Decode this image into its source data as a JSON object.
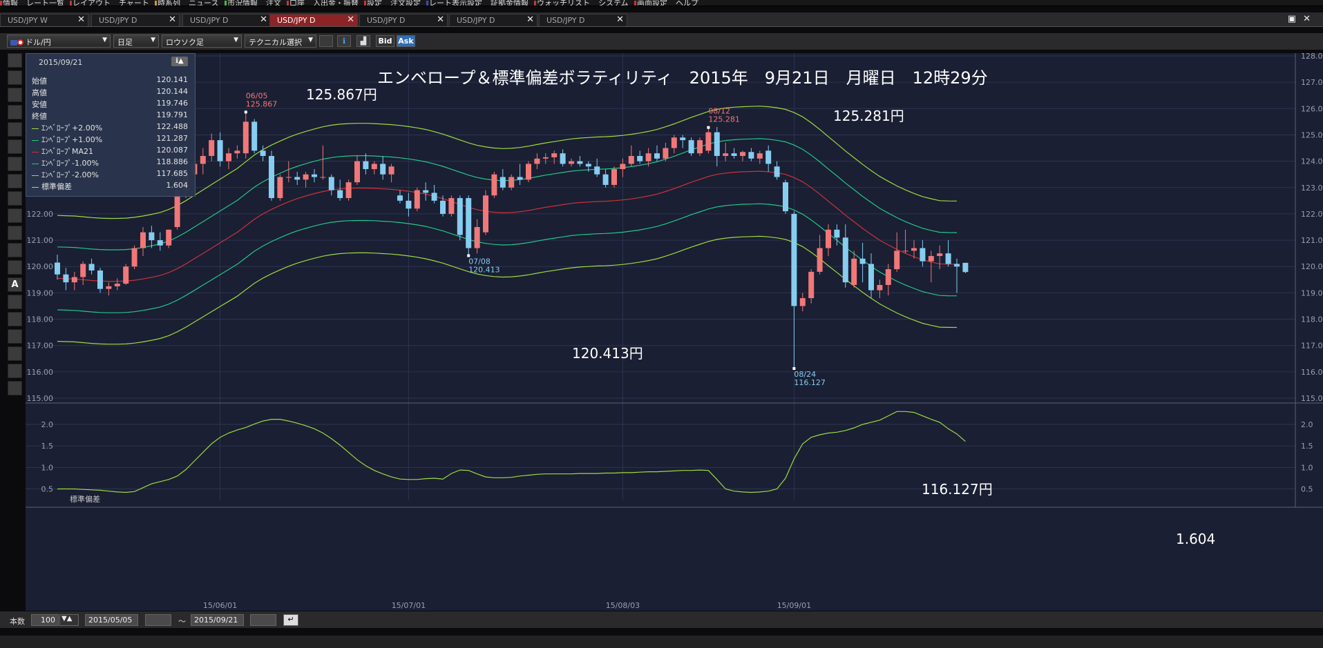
{
  "menu": {
    "items": [
      "情報",
      "レート一覧",
      "レイアウト",
      "チャート",
      "時系列",
      "ニュース",
      "市況情報",
      "注文",
      "口座",
      "入出金・振替",
      "設定",
      "注文設定",
      "レート表示設定",
      "証拠金情報",
      "ウォッチリスト",
      "システム",
      "画面設定",
      "ヘルプ"
    ]
  },
  "tabs": [
    {
      "label": "USD/JPY W",
      "active": false
    },
    {
      "label": "USD/JPY D",
      "active": false
    },
    {
      "label": "USD/JPY D",
      "active": false
    },
    {
      "label": "USD/JPY D",
      "active": true
    },
    {
      "label": "USD/JPY D",
      "active": false
    },
    {
      "label": "USD/JPY D",
      "active": false
    },
    {
      "label": "USD/JPY D",
      "active": false
    }
  ],
  "toolbar": {
    "currency_pair": "ドル/円",
    "timeframe": "日足",
    "chart_type": "ロウソク足",
    "technical_select": "テクニカル選択",
    "bid_label": "Bid",
    "ask_label": "Ask"
  },
  "info_panel": {
    "date": "2015/09/21",
    "rows": [
      {
        "label": "始値",
        "value": "120.141",
        "color": ""
      },
      {
        "label": "高値",
        "value": "120.144",
        "color": ""
      },
      {
        "label": "安値",
        "value": "119.746",
        "color": ""
      },
      {
        "label": "終値",
        "value": "119.791",
        "color": ""
      },
      {
        "label": "ｴﾝﾍﾞﾛｰﾌﾟ+2.00%",
        "value": "122.488",
        "color": "#9edc3e"
      },
      {
        "label": "ｴﾝﾍﾞﾛｰﾌﾟ+1.00%",
        "value": "121.287",
        "color": "#22c98a"
      },
      {
        "label": "ｴﾝﾍﾞﾛｰﾌﾟMA21",
        "value": "120.087",
        "color": "#d0313a"
      },
      {
        "label": "ｴﾝﾍﾞﾛｰﾌﾟ-1.00%",
        "value": "118.886",
        "color": "#22c98a"
      },
      {
        "label": "ｴﾝﾍﾞﾛｰﾌﾟ-2.00%",
        "value": "117.685",
        "color": "#9edc3e"
      },
      {
        "label": "標準偏差",
        "value": "1.604",
        "color": "#9ecfe8"
      }
    ]
  },
  "overlay": {
    "title": "エンベロープ＆標準偏差ボラティリティ　2015年　9月21日　月曜日　12時29分",
    "high1": "125.867円",
    "high2": "125.281円",
    "low1": "120.413円",
    "low2": "116.127円",
    "sd_value": "1.604"
  },
  "chart_data": {
    "type": "candlestick",
    "x_tick_labels": [
      "15/06/01",
      "15/07/01",
      "15/08/03",
      "15/09/01"
    ],
    "y_range": [
      115.0,
      128.0
    ],
    "y_tick_labels": [
      "128.00",
      "127.00",
      "126.00",
      "125.00",
      "124.00",
      "123.00",
      "122.00",
      "121.00",
      "120.00",
      "119.00",
      "118.00",
      "117.00",
      "116.00",
      "115.00"
    ],
    "colors": {
      "up": "#f07878",
      "down": "#86cdf0",
      "ma": "#d0313a",
      "env1": "#22c98a",
      "env2": "#9edc3e",
      "sd": "#9edc3e"
    },
    "ohlc": [
      [
        120.15,
        120.45,
        119.5,
        119.7
      ],
      [
        119.7,
        119.95,
        119.1,
        119.4
      ],
      [
        119.4,
        119.8,
        119.1,
        119.6
      ],
      [
        119.6,
        120.2,
        119.3,
        120.1
      ],
      [
        120.1,
        120.3,
        119.7,
        119.85
      ],
      [
        119.85,
        119.95,
        119.0,
        119.15
      ],
      [
        119.15,
        119.4,
        118.9,
        119.25
      ],
      [
        119.25,
        119.55,
        119.1,
        119.35
      ],
      [
        119.35,
        120.1,
        119.3,
        120.0
      ],
      [
        120.0,
        120.8,
        119.9,
        120.7
      ],
      [
        120.7,
        121.5,
        120.4,
        121.3
      ],
      [
        121.3,
        121.55,
        120.7,
        121.0
      ],
      [
        121.0,
        121.3,
        120.6,
        120.8
      ],
      [
        120.8,
        121.4,
        120.7,
        121.4
      ],
      [
        121.5,
        123.1,
        121.4,
        122.9
      ],
      [
        122.9,
        123.8,
        122.6,
        123.5
      ],
      [
        123.5,
        124.3,
        123.3,
        123.9
      ],
      [
        123.9,
        124.5,
        123.5,
        124.2
      ],
      [
        124.2,
        125.05,
        124.0,
        124.8
      ],
      [
        124.8,
        125.1,
        123.8,
        124.0
      ],
      [
        124.0,
        124.5,
        123.7,
        124.3
      ],
      [
        124.3,
        124.6,
        124.1,
        124.4
      ],
      [
        124.3,
        125.867,
        124.1,
        125.5
      ],
      [
        125.5,
        125.6,
        124.3,
        124.4
      ],
      [
        124.4,
        124.6,
        124.0,
        124.2
      ],
      [
        124.2,
        124.4,
        122.5,
        122.6
      ],
      [
        122.6,
        123.5,
        122.5,
        123.4
      ],
      [
        123.4,
        124.0,
        123.2,
        123.4
      ],
      [
        123.4,
        123.6,
        123.1,
        123.3
      ],
      [
        123.3,
        123.6,
        123.0,
        123.5
      ],
      [
        123.5,
        123.7,
        123.2,
        123.4
      ],
      [
        123.4,
        124.6,
        123.3,
        123.4
      ],
      [
        123.4,
        123.5,
        122.7,
        122.9
      ],
      [
        122.9,
        123.3,
        122.5,
        122.6
      ],
      [
        122.6,
        123.3,
        122.5,
        123.2
      ],
      [
        123.2,
        124.2,
        123.1,
        124.0
      ],
      [
        124.0,
        124.3,
        123.5,
        123.7
      ],
      [
        123.7,
        124.0,
        123.5,
        123.9
      ],
      [
        123.9,
        124.2,
        123.3,
        123.5
      ],
      [
        123.5,
        123.9,
        123.2,
        123.8
      ],
      [
        122.7,
        122.9,
        122.4,
        122.5
      ],
      [
        122.5,
        122.8,
        121.9,
        122.2
      ],
      [
        122.2,
        123.0,
        122.1,
        122.9
      ],
      [
        122.9,
        123.2,
        122.5,
        122.8
      ],
      [
        122.8,
        123.1,
        122.4,
        122.5
      ],
      [
        122.5,
        122.7,
        121.9,
        122.0
      ],
      [
        122.0,
        122.7,
        121.9,
        122.6
      ],
      [
        122.6,
        122.7,
        121.0,
        121.2
      ],
      [
        122.6,
        122.7,
        120.413,
        120.7
      ],
      [
        120.7,
        121.8,
        120.5,
        121.5
      ],
      [
        121.3,
        122.9,
        121.2,
        122.7
      ],
      [
        122.7,
        123.6,
        122.6,
        123.5
      ],
      [
        123.4,
        123.7,
        122.9,
        123.0
      ],
      [
        123.0,
        123.5,
        122.9,
        123.4
      ],
      [
        123.4,
        123.9,
        123.1,
        123.3
      ],
      [
        123.3,
        124.0,
        123.2,
        123.9
      ],
      [
        123.9,
        124.3,
        123.7,
        124.1
      ],
      [
        124.1,
        124.3,
        123.9,
        124.15
      ],
      [
        124.15,
        124.4,
        123.9,
        124.3
      ],
      [
        124.3,
        124.45,
        123.8,
        123.9
      ],
      [
        123.9,
        124.1,
        123.8,
        124.0
      ],
      [
        124.0,
        124.2,
        123.8,
        123.9
      ],
      [
        123.9,
        124.0,
        123.6,
        123.8
      ],
      [
        123.8,
        124.1,
        123.4,
        123.5
      ],
      [
        123.5,
        123.7,
        123.0,
        123.1
      ],
      [
        123.1,
        123.8,
        123.0,
        123.7
      ],
      [
        123.7,
        124.1,
        123.4,
        123.9
      ],
      [
        123.9,
        124.6,
        123.8,
        124.2
      ],
      [
        124.2,
        124.4,
        123.9,
        124.0
      ],
      [
        124.0,
        124.5,
        123.8,
        124.3
      ],
      [
        124.3,
        124.6,
        124.0,
        124.1
      ],
      [
        124.1,
        124.7,
        124.0,
        124.5
      ],
      [
        124.5,
        125.0,
        124.3,
        124.9
      ],
      [
        124.9,
        125.0,
        124.5,
        124.8
      ],
      [
        124.8,
        124.9,
        124.2,
        124.3
      ],
      [
        124.3,
        124.9,
        124.2,
        124.8
      ],
      [
        124.4,
        125.281,
        124.3,
        125.1
      ],
      [
        125.1,
        125.3,
        123.8,
        124.2
      ],
      [
        124.2,
        124.7,
        124.0,
        124.3
      ],
      [
        124.3,
        124.5,
        124.1,
        124.2
      ],
      [
        124.2,
        124.4,
        124.0,
        124.35
      ],
      [
        124.35,
        124.5,
        124.0,
        124.1
      ],
      [
        124.1,
        124.4,
        123.9,
        124.3
      ],
      [
        124.4,
        124.6,
        123.6,
        123.9
      ],
      [
        123.8,
        124.0,
        123.3,
        123.4
      ],
      [
        123.2,
        123.3,
        122.0,
        122.1
      ],
      [
        122.0,
        122.1,
        116.127,
        118.5
      ],
      [
        118.5,
        119.0,
        118.3,
        118.8
      ],
      [
        118.8,
        119.9,
        118.6,
        119.8
      ],
      [
        119.8,
        121.2,
        119.7,
        120.7
      ],
      [
        120.7,
        121.6,
        120.4,
        121.4
      ],
      [
        121.4,
        121.6,
        120.8,
        121.1
      ],
      [
        121.1,
        121.6,
        119.2,
        119.4
      ],
      [
        119.3,
        120.6,
        119.2,
        120.3
      ],
      [
        120.3,
        120.9,
        119.4,
        120.1
      ],
      [
        120.1,
        120.5,
        118.8,
        119.1
      ],
      [
        119.1,
        119.5,
        118.8,
        119.3
      ],
      [
        119.3,
        120.1,
        118.9,
        119.9
      ],
      [
        119.9,
        121.3,
        119.8,
        120.6
      ],
      [
        120.6,
        121.4,
        120.5,
        120.6
      ],
      [
        120.6,
        121.0,
        120.3,
        120.7
      ],
      [
        120.7,
        121.0,
        120.0,
        120.2
      ],
      [
        120.2,
        120.6,
        119.4,
        120.4
      ],
      [
        120.4,
        120.8,
        119.9,
        120.5
      ],
      [
        120.5,
        121.0,
        120.0,
        120.1
      ],
      [
        120.1,
        120.3,
        119.0,
        120.0
      ],
      [
        120.141,
        120.144,
        119.746,
        119.791
      ]
    ],
    "ma21": [
      119.55,
      119.54,
      119.53,
      119.5,
      119.47,
      119.45,
      119.44,
      119.44,
      119.45,
      119.48,
      119.53,
      119.59,
      119.66,
      119.77,
      119.92,
      120.1,
      120.3,
      120.5,
      120.7,
      120.9,
      121.1,
      121.3,
      121.55,
      121.8,
      122.0,
      122.17,
      122.32,
      122.46,
      122.58,
      122.68,
      122.77,
      122.85,
      122.91,
      122.95,
      122.97,
      122.98,
      122.98,
      122.97,
      122.95,
      122.93,
      122.9,
      122.86,
      122.81,
      122.75,
      122.67,
      122.58,
      122.47,
      122.36,
      122.25,
      122.16,
      122.1,
      122.06,
      122.04,
      122.05,
      122.08,
      122.13,
      122.19,
      122.25,
      122.3,
      122.35,
      122.4,
      122.43,
      122.45,
      122.47,
      122.48,
      122.5,
      122.53,
      122.57,
      122.62,
      122.68,
      122.75,
      122.85,
      122.96,
      123.08,
      123.2,
      123.31,
      123.42,
      123.5,
      123.55,
      123.58,
      123.6,
      123.61,
      123.62,
      123.6,
      123.56,
      123.5,
      123.38,
      123.22,
      123.0,
      122.75,
      122.48,
      122.22,
      121.95,
      121.7,
      121.45,
      121.22,
      121.0,
      120.82,
      120.65,
      120.5,
      120.37,
      120.25,
      120.17,
      120.1,
      120.09,
      120.087
    ],
    "sd": [
      0.5,
      0.5,
      0.5,
      0.49,
      0.48,
      0.47,
      0.45,
      0.43,
      0.42,
      0.44,
      0.53,
      0.62,
      0.67,
      0.72,
      0.8,
      0.95,
      1.15,
      1.35,
      1.55,
      1.7,
      1.8,
      1.87,
      1.93,
      2.01,
      2.08,
      2.12,
      2.12,
      2.08,
      2.03,
      1.97,
      1.9,
      1.8,
      1.67,
      1.52,
      1.35,
      1.18,
      1.04,
      0.93,
      0.85,
      0.78,
      0.73,
      0.72,
      0.72,
      0.74,
      0.75,
      0.73,
      0.86,
      0.94,
      0.93,
      0.85,
      0.78,
      0.76,
      0.76,
      0.77,
      0.8,
      0.82,
      0.84,
      0.85,
      0.85,
      0.85,
      0.85,
      0.86,
      0.86,
      0.86,
      0.87,
      0.87,
      0.88,
      0.88,
      0.89,
      0.9,
      0.9,
      0.91,
      0.92,
      0.93,
      0.93,
      0.94,
      0.93,
      0.72,
      0.5,
      0.45,
      0.43,
      0.42,
      0.43,
      0.45,
      0.5,
      0.75,
      1.2,
      1.55,
      1.7,
      1.76,
      1.8,
      1.82,
      1.86,
      1.92,
      2.0,
      2.05,
      2.1,
      2.2,
      2.3,
      2.3,
      2.28,
      2.2,
      2.12,
      2.05,
      1.9,
      1.78,
      1.604
    ],
    "sd_range": [
      0.3,
      2.45
    ],
    "sd_tick_labels": [
      "2.0",
      "1.5",
      "1.0",
      "0.5"
    ],
    "sd_panel_label": "標準偏差",
    "annotations": [
      {
        "date": "06/05",
        "value": "125.867",
        "color": "#f07878"
      },
      {
        "date": "07/08",
        "value": "120.413",
        "color": "#86cdf0"
      },
      {
        "date": "08/12",
        "value": "125.281",
        "color": "#f07878"
      },
      {
        "date": "08/24",
        "value": "116.127",
        "color": "#86cdf0"
      }
    ]
  },
  "bottom": {
    "count_label": "本数",
    "count_value": "100",
    "from_date": "2015/05/05",
    "tilde": "～",
    "to_date": "2015/09/21"
  }
}
